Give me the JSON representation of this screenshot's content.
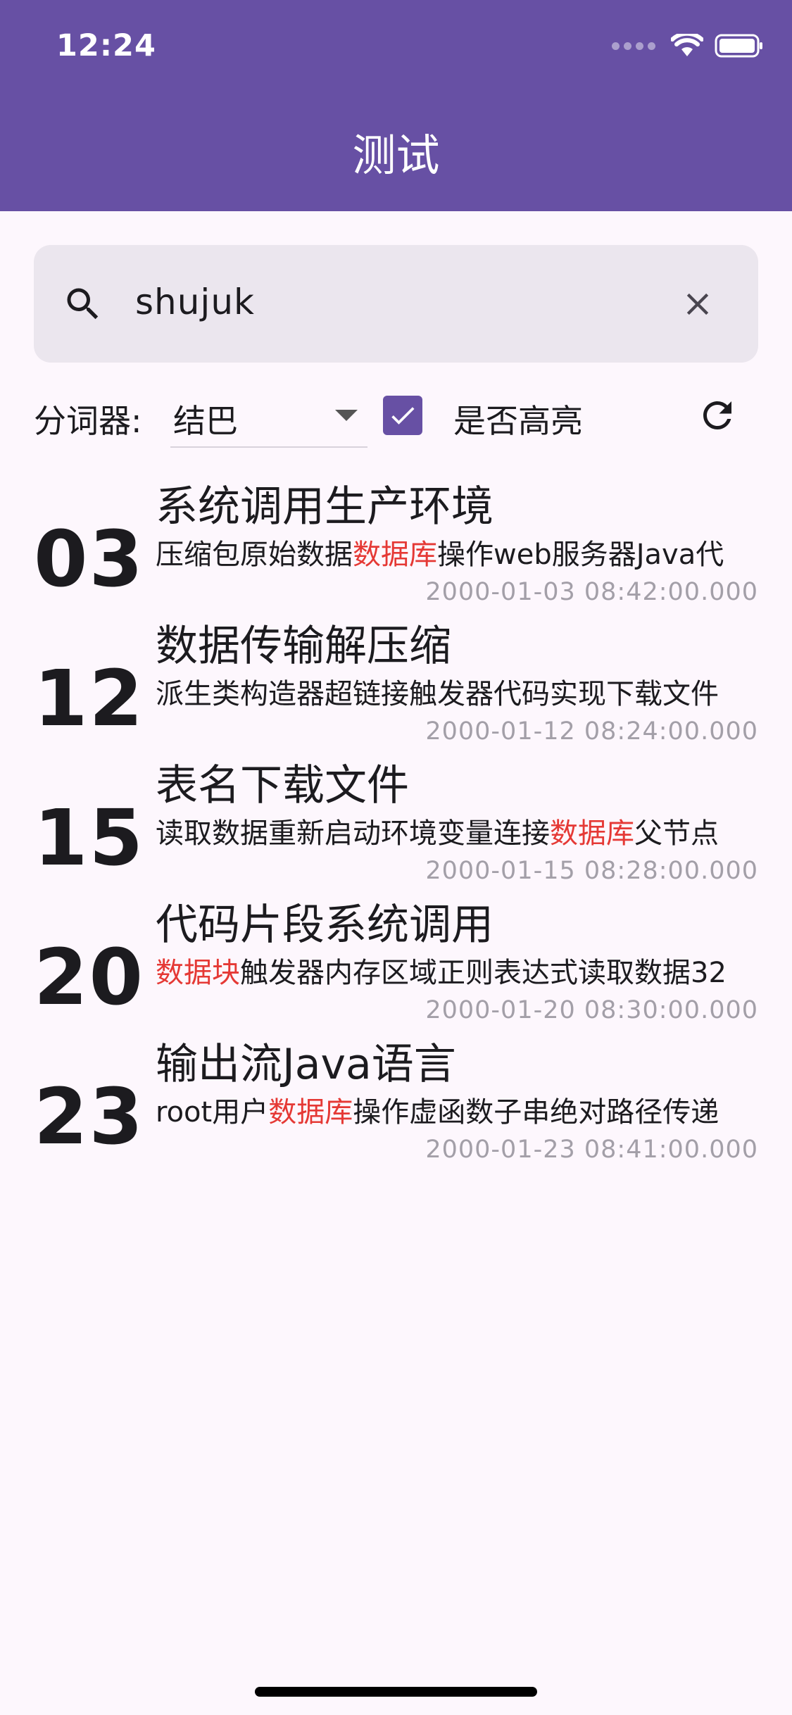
{
  "status_bar": {
    "time": "12:24"
  },
  "app_bar": {
    "title": "测试",
    "color": "#6750a4"
  },
  "search": {
    "query": "shujuk"
  },
  "controls": {
    "segmenter_label": "分词器:",
    "segmenter_value": "结巴",
    "highlight_checked": true,
    "highlight_label": "是否高亮"
  },
  "results": [
    {
      "day": "03",
      "title": "系统调用生产环境",
      "snippet": [
        {
          "text": "压缩包原始数据",
          "highlight": false
        },
        {
          "text": "数据库",
          "highlight": true
        },
        {
          "text": "操作web服务器Java代",
          "highlight": false
        }
      ],
      "time": "2000-01-03 08:42:00.000"
    },
    {
      "day": "12",
      "title": "数据传输解压缩",
      "snippet": [
        {
          "text": "派生类构造器超链接触发器代码实现下载文件",
          "highlight": false
        }
      ],
      "time": "2000-01-12 08:24:00.000"
    },
    {
      "day": "15",
      "title": "表名下载文件",
      "snippet": [
        {
          "text": "读取数据重新启动环境变量连接",
          "highlight": false
        },
        {
          "text": "数据库",
          "highlight": true
        },
        {
          "text": "父节点",
          "highlight": false
        }
      ],
      "time": "2000-01-15 08:28:00.000"
    },
    {
      "day": "20",
      "title": "代码片段系统调用",
      "snippet": [
        {
          "text": "数据块",
          "highlight": true
        },
        {
          "text": "触发器内存区域正则表达式读取数据32",
          "highlight": false
        }
      ],
      "time": "2000-01-20 08:30:00.000"
    },
    {
      "day": "23",
      "title": "输出流Java语言",
      "snippet": [
        {
          "text": "root用户",
          "highlight": false
        },
        {
          "text": "数据库",
          "highlight": true
        },
        {
          "text": "操作虚函数子串绝对路径传递",
          "highlight": false
        }
      ],
      "time": "2000-01-23 08:41:00.000"
    }
  ],
  "highlight_color": "#e53935"
}
